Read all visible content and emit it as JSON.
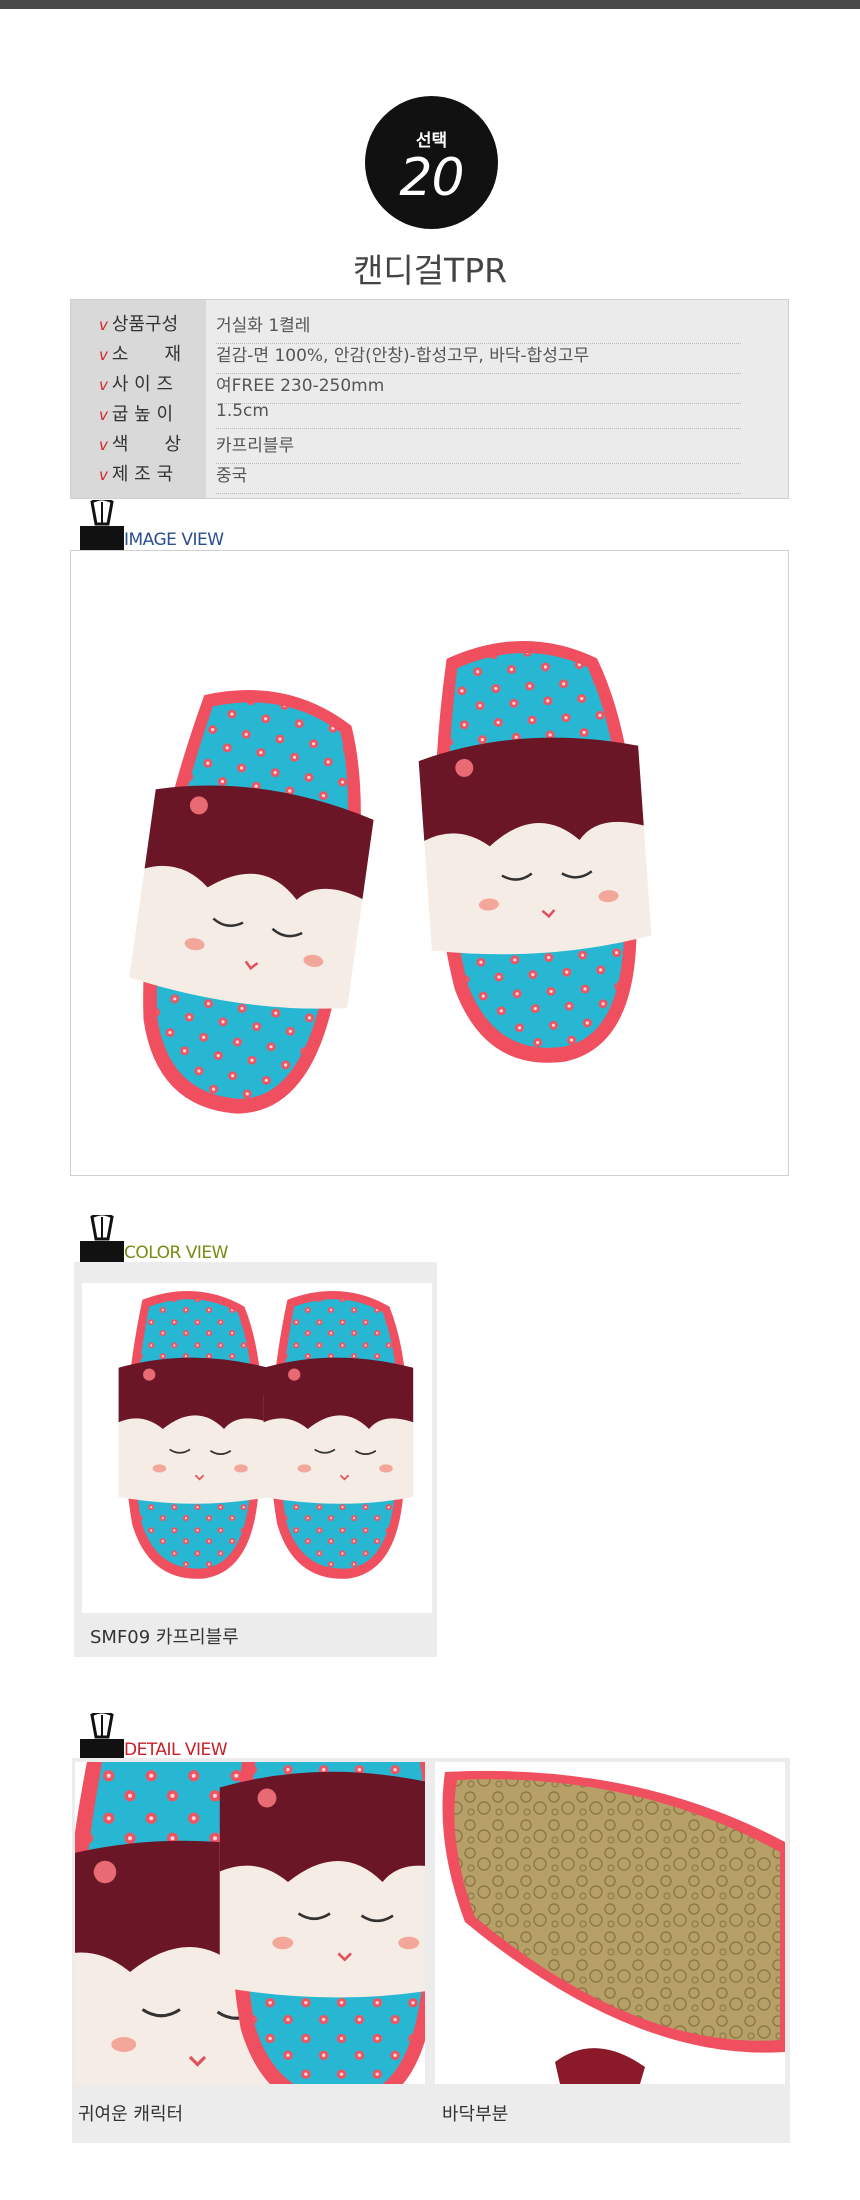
{
  "badge": {
    "label": "선택",
    "number": "20"
  },
  "product_title": "캔디걸TPR",
  "spec": {
    "check_mark": "v",
    "rows": [
      {
        "key": "상품구성",
        "value": "거실화 1켤레"
      },
      {
        "key": "소　　재",
        "value": "겉감-면 100%, 안감(안창)-합성고무, 바닥-합성고무"
      },
      {
        "key": "사 이 즈",
        "value": "여FREE 230-250mm"
      },
      {
        "key": "굽 높 이",
        "value": "1.5cm"
      },
      {
        "key": "색　　상",
        "value": "카프리블루"
      },
      {
        "key": "제 조 국",
        "value": "중국"
      }
    ]
  },
  "sections": {
    "image_view": {
      "label": "IMAGE VIEW",
      "color": "#2a4f8f"
    },
    "color_view": {
      "label": "COLOR VIEW",
      "color": "#7a8a12",
      "caption": "SMF09 카프리블루"
    },
    "detail_view": {
      "label": "DETAIL VIEW",
      "color": "#c81e28",
      "captions": [
        "귀여운 캐릭터",
        "바닥부분"
      ]
    }
  },
  "colors": {
    "pink": "#ef4f5f",
    "aqua": "#27b7d2",
    "maroon": "#6b1626",
    "face": "#f5ece6",
    "sole": "#b39c62"
  }
}
